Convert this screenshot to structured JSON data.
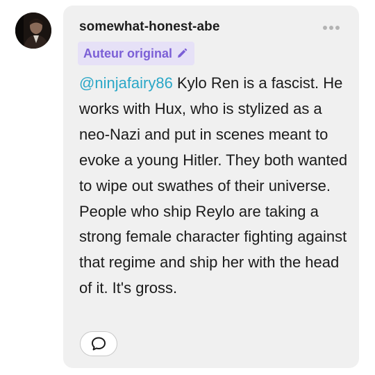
{
  "comment": {
    "author": "somewhat-honest-abe",
    "badge_label": "Auteur original",
    "mention": "@ninjafairy86",
    "text": " Kylo Ren is a fascist. He works with Hux, who is stylized as a neo-Nazi and put in scenes meant to evoke a young Hitler. They both wanted to wipe out swathes of their universe. People who ship Reylo are taking a strong female character fighting against that regime and ship her with the head of it. It's gross."
  },
  "icons": {
    "more": "ellipsis-icon",
    "badge": "pencil-icon",
    "reply": "speech-bubble-icon"
  },
  "colors": {
    "card_background": "#f0f0f0",
    "badge_background": "#e6e1f7",
    "badge_text": "#7b5fd6",
    "mention": "#2aa7c7"
  }
}
